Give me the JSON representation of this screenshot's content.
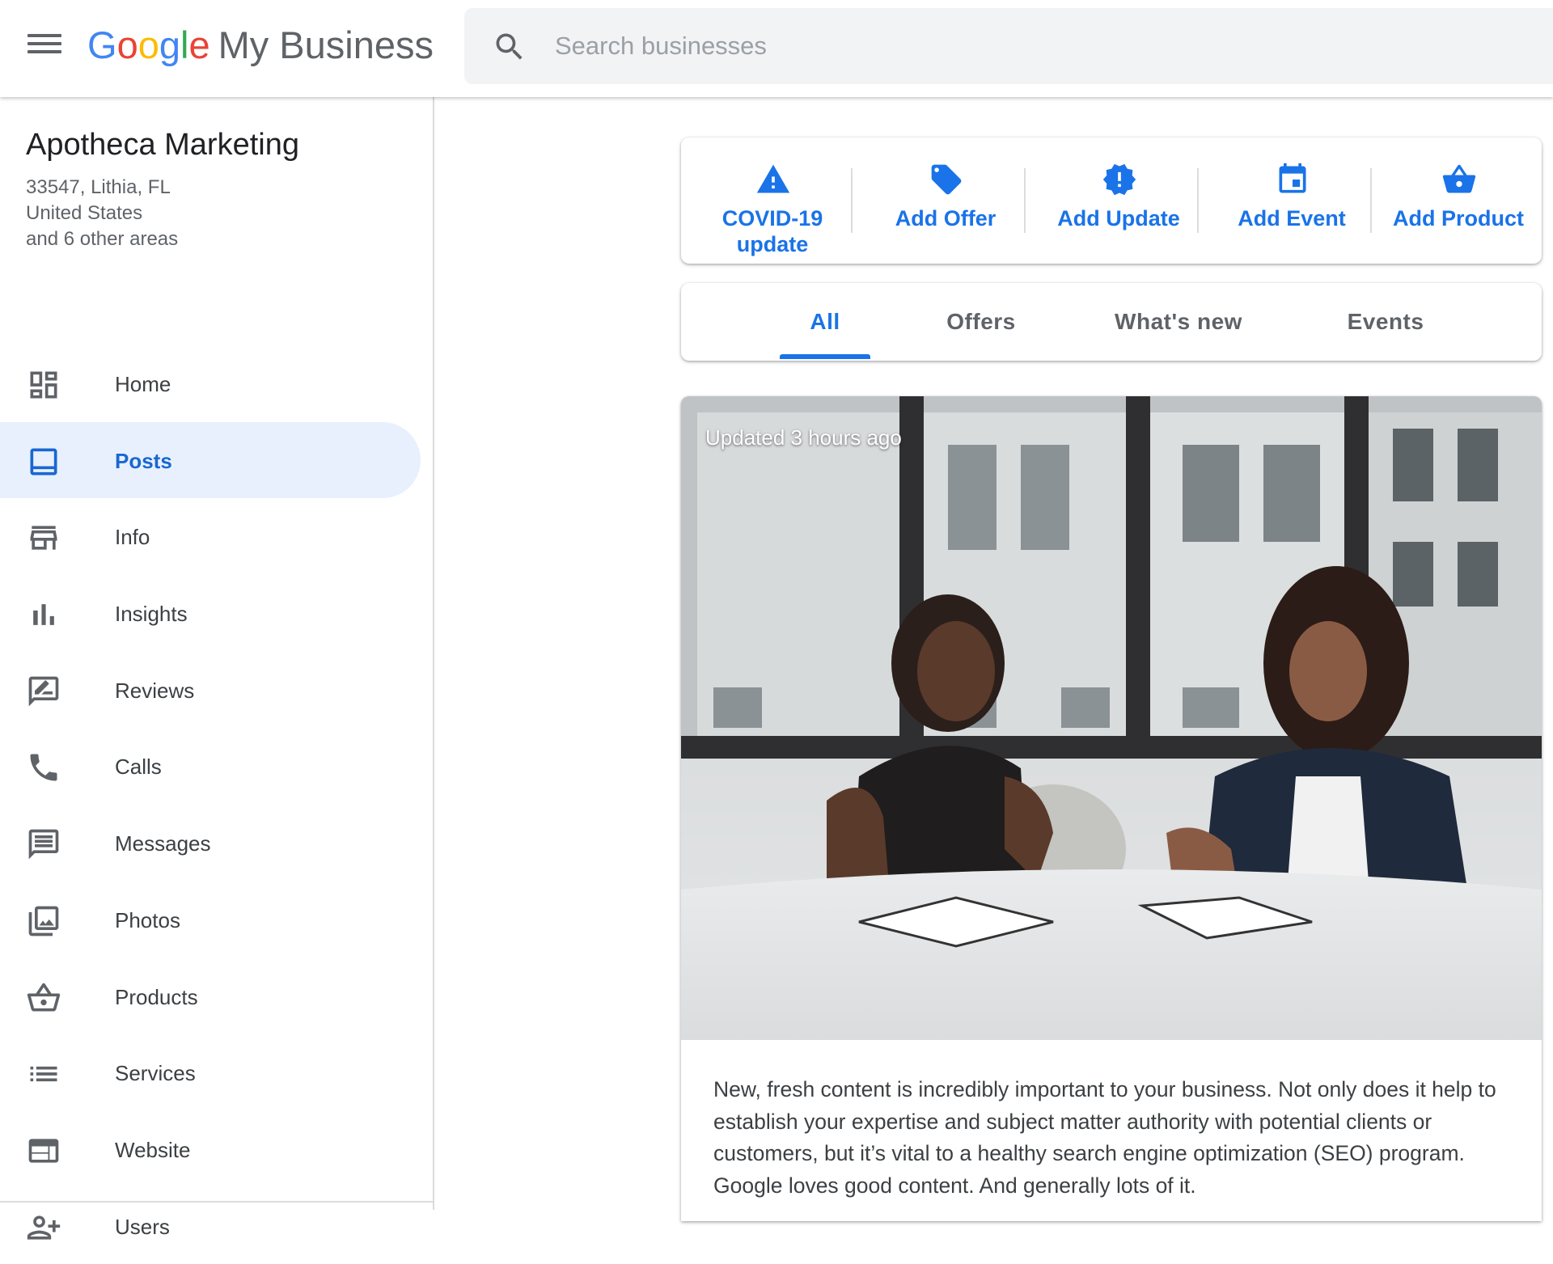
{
  "header": {
    "logo_google": [
      "G",
      "o",
      "o",
      "g",
      "l",
      "e"
    ],
    "logo_product": "My Business",
    "search_placeholder": "Search businesses"
  },
  "business": {
    "name": "Apotheca Marketing",
    "address_line1": "33547, Lithia, FL",
    "address_line2": "United States",
    "address_line3": "and 6 other areas"
  },
  "sidebar": {
    "items": [
      {
        "label": "Home",
        "icon": "dashboard-icon"
      },
      {
        "label": "Posts",
        "icon": "posts-icon",
        "active": true
      },
      {
        "label": "Info",
        "icon": "storefront-icon"
      },
      {
        "label": "Insights",
        "icon": "bar-chart-icon"
      },
      {
        "label": "Reviews",
        "icon": "rate-review-icon"
      },
      {
        "label": "Calls",
        "icon": "phone-icon"
      },
      {
        "label": "Messages",
        "icon": "message-icon"
      },
      {
        "label": "Photos",
        "icon": "photo-library-icon"
      },
      {
        "label": "Products",
        "icon": "shopping-basket-icon"
      },
      {
        "label": "Services",
        "icon": "list-icon"
      },
      {
        "label": "Website",
        "icon": "web-icon"
      },
      {
        "label": "Users",
        "icon": "person-add-icon"
      }
    ]
  },
  "actions": [
    {
      "line1": "COVID-19",
      "line2": "update",
      "icon": "warning-icon"
    },
    {
      "line1": "Add Offer",
      "line2": "",
      "icon": "tag-icon"
    },
    {
      "line1": "Add Update",
      "line2": "",
      "icon": "new-releases-icon"
    },
    {
      "line1": "Add Event",
      "line2": "",
      "icon": "event-icon"
    },
    {
      "line1": "Add Product",
      "line2": "",
      "icon": "shopping-basket-icon"
    }
  ],
  "tabs": [
    {
      "label": "All",
      "active": true
    },
    {
      "label": "Offers"
    },
    {
      "label": "What's new"
    },
    {
      "label": "Events"
    }
  ],
  "post": {
    "updated": "Updated 3 hours ago",
    "body": "New, fresh content is incredibly important to your business. Not only does it help to establish your expertise and subject matter authority with potential clients or customers, but it’s vital to a healthy search engine optimization (SEO) program. Google loves good content. And generally lots of it."
  },
  "colors": {
    "accent": "#1a73e8",
    "active_bg": "#e8f0fe",
    "text": "#3c4043",
    "muted": "#5f6368"
  }
}
